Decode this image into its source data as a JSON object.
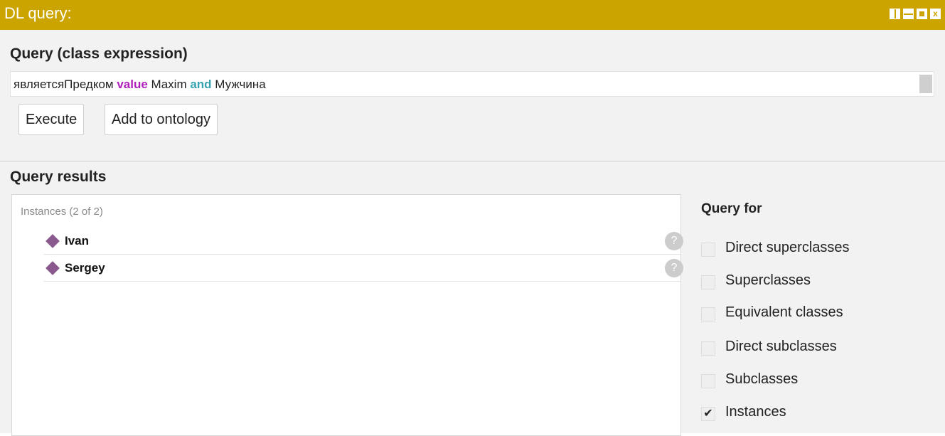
{
  "window": {
    "title": "DL query:",
    "controls": [
      "split-vertical-icon",
      "split-horizontal-icon",
      "maximize-icon",
      "close-icon"
    ],
    "close_glyph": "x",
    "accent_color": "#cca400"
  },
  "query": {
    "heading": "Query (class expression)",
    "expression": {
      "part1": "являетсяПредком ",
      "kw1": "value",
      "part2": " Maxim ",
      "kw2": "and",
      "part3": " Мужчина"
    },
    "execute_label": "Execute",
    "add_label": "Add to ontology"
  },
  "results": {
    "heading": "Query results",
    "caption": "Instances (2 of 2)",
    "help_glyph": "?",
    "items": [
      {
        "label": "Ivan"
      },
      {
        "label": "Sergey"
      }
    ]
  },
  "query_for": {
    "heading": "Query for",
    "checkmark": "✔",
    "options": [
      {
        "label": "Direct superclasses",
        "checked": false
      },
      {
        "label": "Superclasses",
        "checked": false
      },
      {
        "label": "Equivalent classes",
        "checked": false
      },
      {
        "label": "Direct subclasses",
        "checked": false
      },
      {
        "label": "Subclasses",
        "checked": false
      },
      {
        "label": "Instances",
        "checked": true
      }
    ]
  }
}
